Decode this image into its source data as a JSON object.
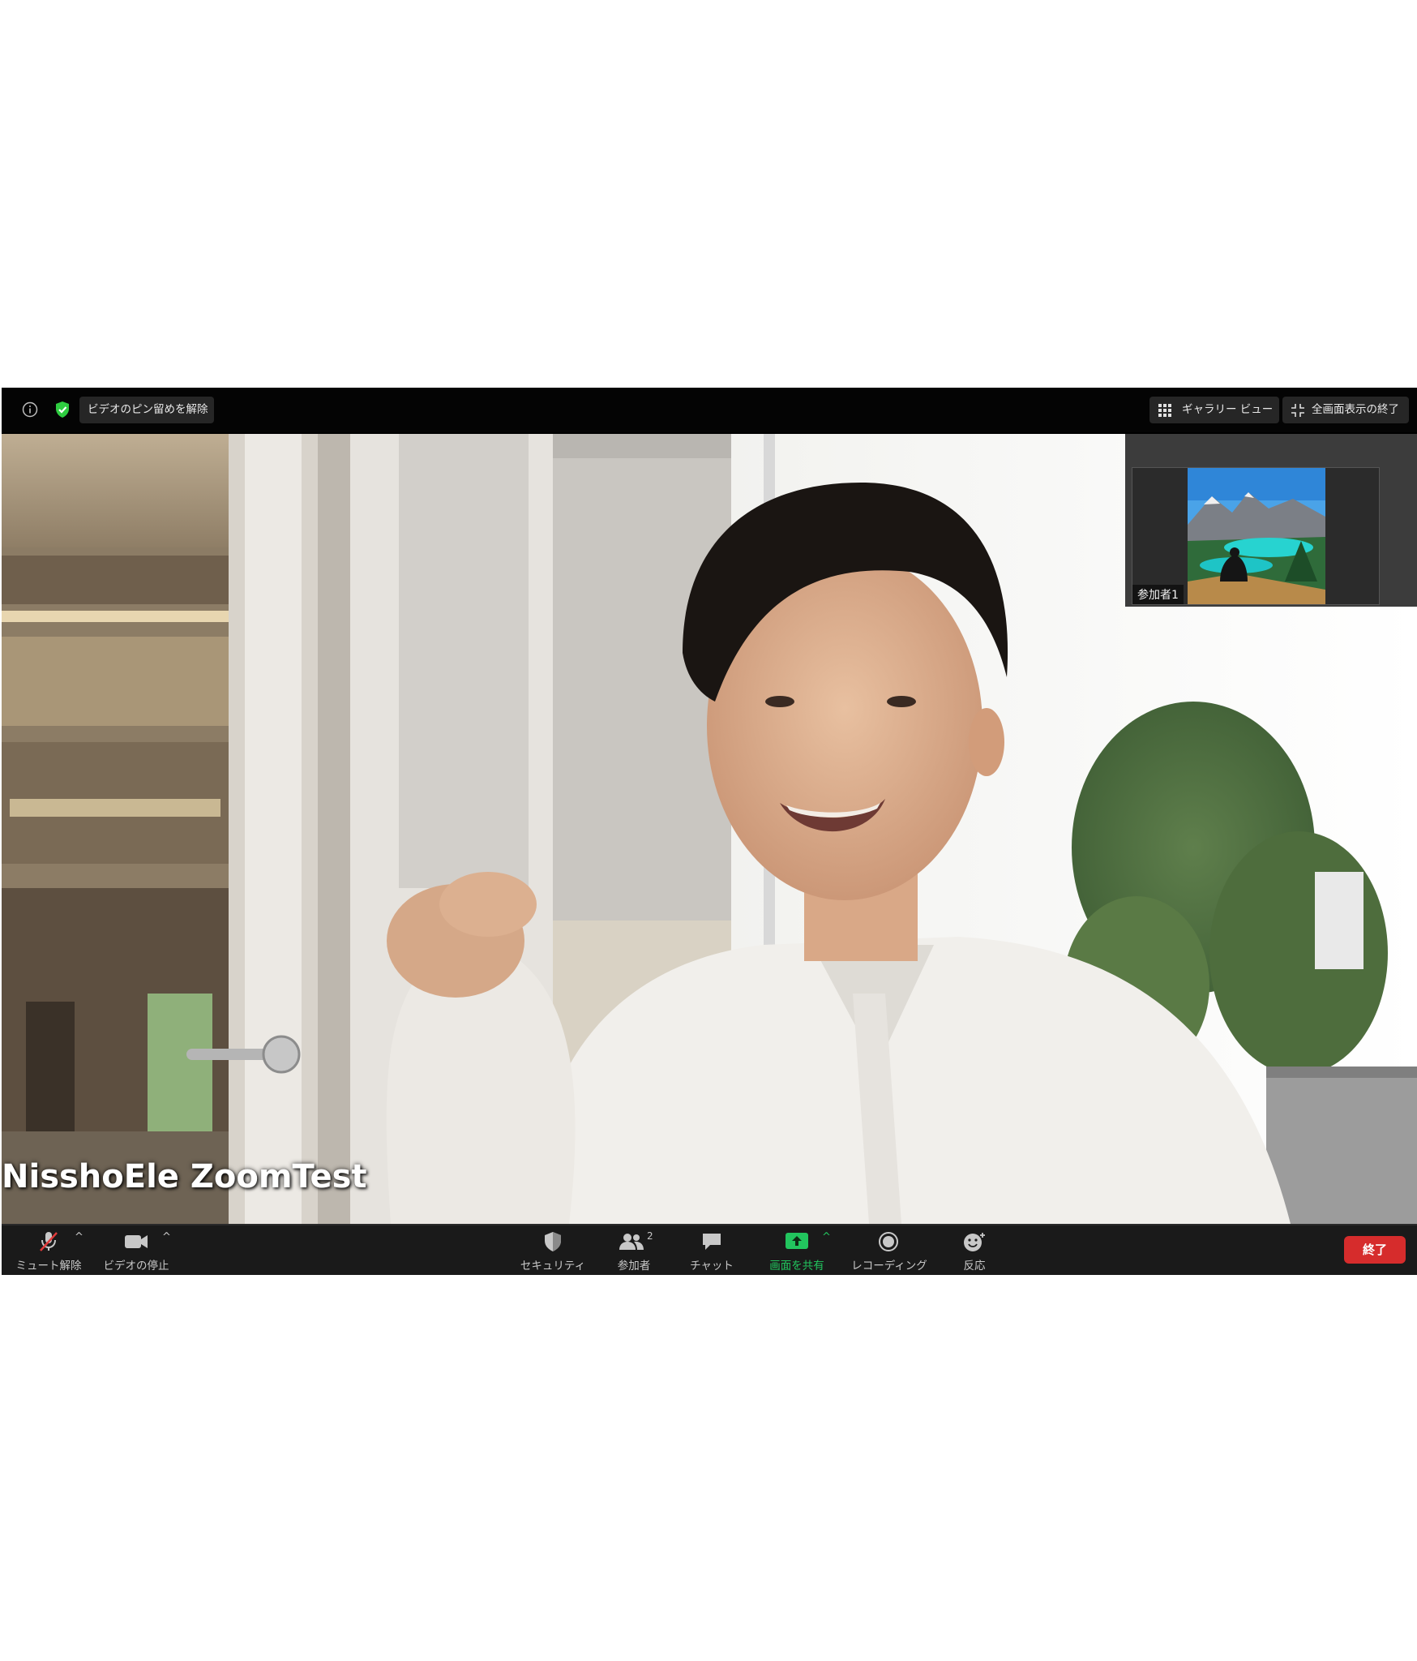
{
  "top_bar": {
    "unpin_label": "ビデオのピン留めを解除",
    "gallery_label": "ギャラリー ビュー",
    "exit_fullscreen_label": "全画面表示の終了",
    "encryption_color": "#2ecc40"
  },
  "main_video": {
    "speaker_name": "NisshoEle ZoomTest"
  },
  "thumbnail": {
    "participant_label": "参加者1"
  },
  "toolbar": {
    "mute_label": "ミュート解除",
    "video_label": "ビデオの停止",
    "security_label": "セキュリティ",
    "participants_label": "参加者",
    "participants_count": "2",
    "chat_label": "チャット",
    "share_label": "画面を共有",
    "record_label": "レコーディング",
    "reactions_label": "反応",
    "end_label": "終了",
    "share_color": "#22c55e",
    "end_color": "#d62c2c"
  }
}
